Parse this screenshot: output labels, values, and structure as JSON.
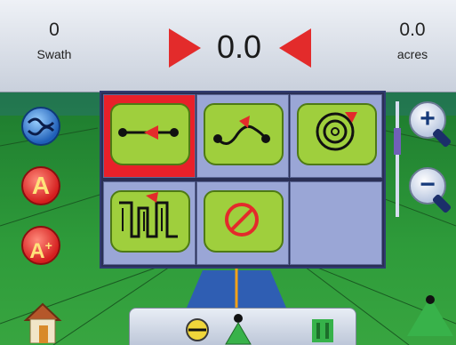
{
  "status": {
    "swath": {
      "value": "0",
      "label": "Swath"
    },
    "offline_distance": {
      "value": "0.0"
    },
    "area": {
      "value": "0.0",
      "label": "acres"
    }
  },
  "guidance_modes": [
    {
      "name": "straight-ab",
      "icon": "straight-ab-icon",
      "selected": true
    },
    {
      "name": "curved-ab",
      "icon": "curved-ab-icon",
      "selected": false
    },
    {
      "name": "circle-pivot",
      "icon": "circle-pivot-icon",
      "selected": false
    },
    {
      "name": "last-pass",
      "icon": "last-pass-icon",
      "selected": false
    },
    {
      "name": "no-guidance",
      "icon": "no-guidance-icon",
      "selected": false
    },
    {
      "name": "empty",
      "icon": "",
      "selected": false
    }
  ],
  "left_buttons": {
    "swath_icon": "swath-toggle-icon",
    "a_label": "A",
    "aplus_label": "A+"
  },
  "zoom": {
    "in_icon": "zoom-in-icon",
    "out_icon": "zoom-out-icon"
  },
  "colors": {
    "accent_red": "#e32b2b",
    "panel_green": "#9fcf3d",
    "field_green": "#2e9b3a"
  }
}
